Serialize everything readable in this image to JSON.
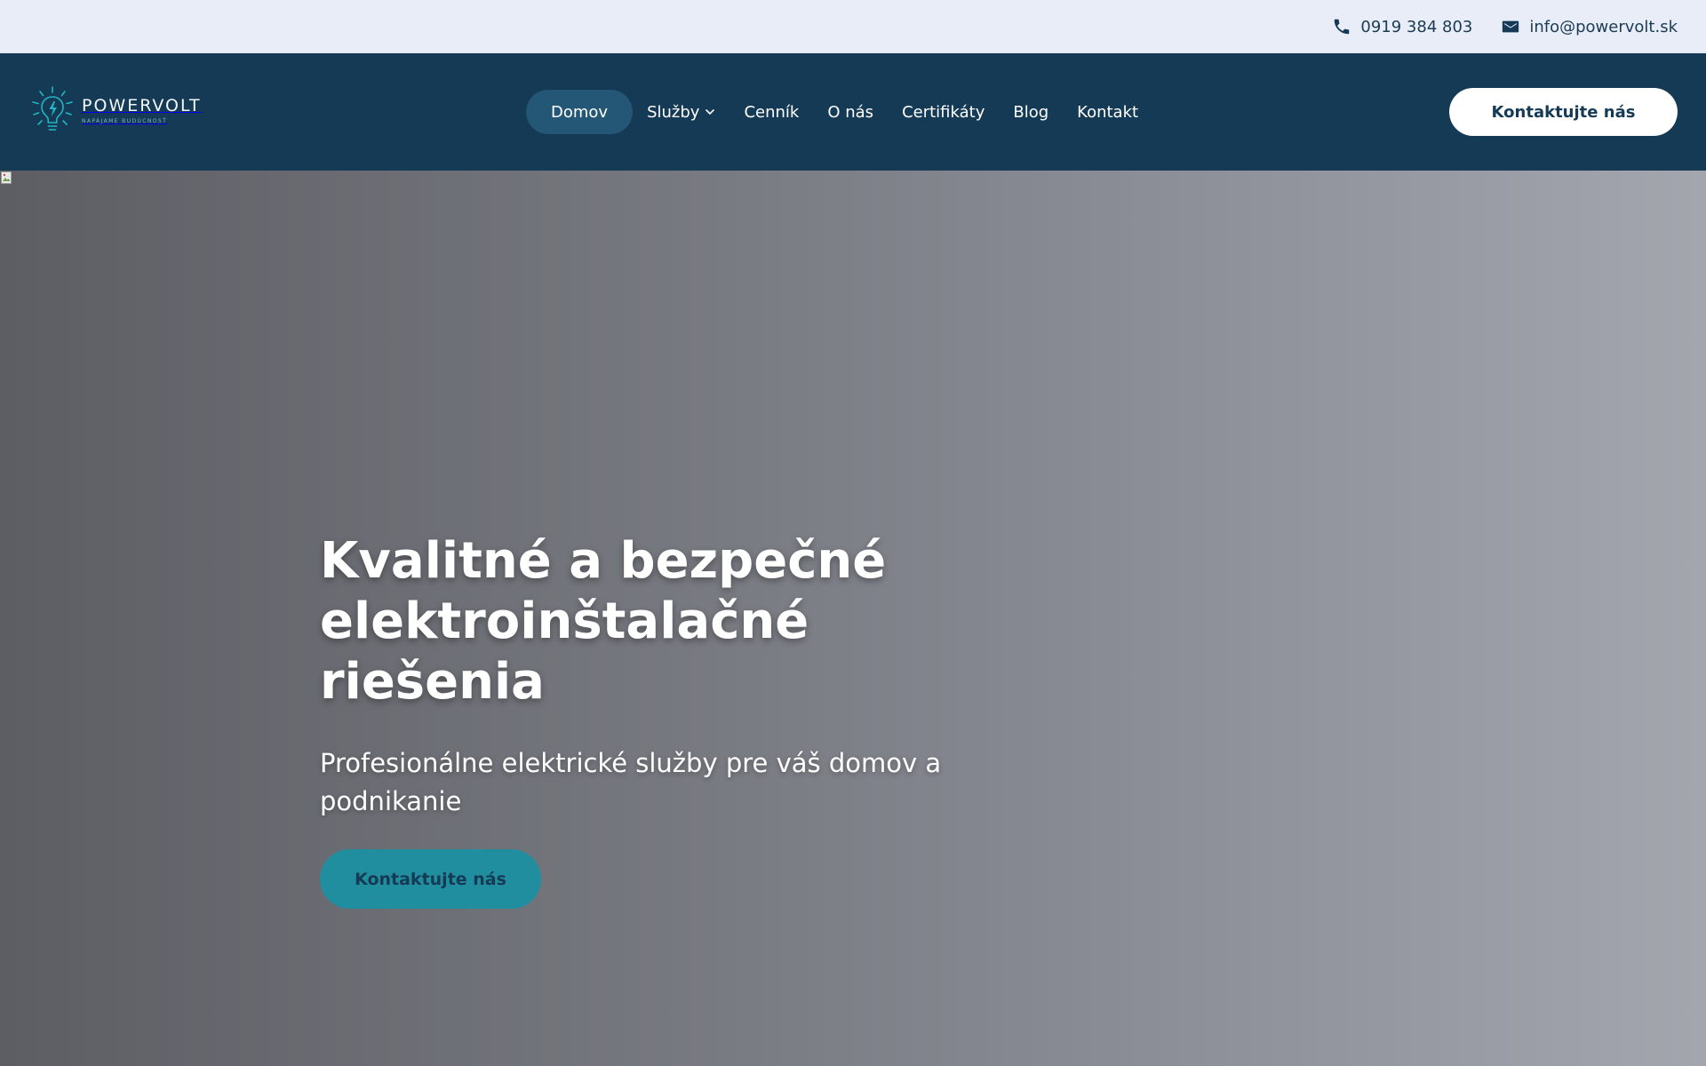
{
  "topbar": {
    "phone": "0919 384 803",
    "email": "info@powervolt.sk"
  },
  "header": {
    "logo": {
      "name": "POWERVOLT",
      "tagline": "NAPÁJAME BUDÚCNOSŤ"
    },
    "nav": {
      "items": [
        {
          "label": "Domov",
          "active": true
        },
        {
          "label": "Služby",
          "has_dropdown": true
        },
        {
          "label": "Cenník"
        },
        {
          "label": "O nás"
        },
        {
          "label": "Certifikáty"
        },
        {
          "label": "Blog"
        },
        {
          "label": "Kontakt"
        }
      ]
    },
    "cta_label": "Kontaktujte nás"
  },
  "hero": {
    "title_line1": "Kvalitné a bezpečné",
    "title_line2": "elektroinštalačné riešenia",
    "subtitle_line1": "Profesionálne elektrické služby pre váš domov a",
    "subtitle_line2": "podnikanie",
    "cta_label": "Kontaktujte nás"
  },
  "icons": {
    "phone": "phone-icon",
    "email": "envelope-icon",
    "dropdown": "chevron-down-icon",
    "logo": "lightbulb-icon"
  },
  "colors": {
    "topbar_bg": "#e8edf8",
    "navbar_bg": "#153a55",
    "nav_active_bg": "#245775",
    "accent": "#218e9f",
    "text_dark": "#153a55"
  }
}
